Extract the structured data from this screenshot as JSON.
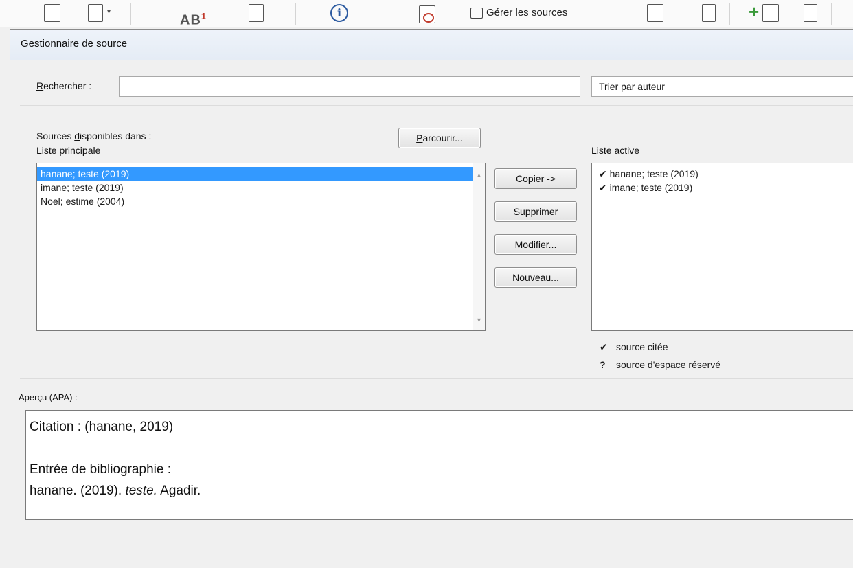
{
  "ribbon": {
    "manage_sources_label": "Gérer les sources",
    "ab_label": "AB",
    "ab_sup": "1",
    "info_glyph": "i"
  },
  "dialog": {
    "title": "Gestionnaire de source",
    "search": {
      "label_prefix": "R",
      "label_rest": "echercher :",
      "value": "",
      "placeholder": ""
    },
    "sort": {
      "selected": "Trier par auteur"
    },
    "available": {
      "label_line1_prefix": "Sources ",
      "label_line1_u": "d",
      "label_line1_rest": "isponibles dans :",
      "label_line2": "Liste principale",
      "browse_u": "P",
      "browse_rest": "arcourir...",
      "items": [
        {
          "text": "hanane; teste (2019)",
          "selected": true
        },
        {
          "text": "imane; teste (2019)",
          "selected": false
        },
        {
          "text": "Noel; estime (2004)",
          "selected": false
        }
      ]
    },
    "actions": {
      "copy_u": "C",
      "copy_rest": "opier ->",
      "delete_u": "S",
      "delete_rest": "upprimer",
      "edit_pre": "Modifi",
      "edit_u": "e",
      "edit_rest": "r...",
      "new_u": "N",
      "new_rest": "ouveau..."
    },
    "active": {
      "label_u": "L",
      "label_rest": "iste active",
      "items": [
        {
          "mark": "✔",
          "text": "hanane; teste (2019)"
        },
        {
          "mark": "✔",
          "text": "imane; teste (2019)"
        }
      ]
    },
    "legend": {
      "cited_symbol": "✔",
      "cited_label": "source citée",
      "placeholder_symbol": "?",
      "placeholder_label": "source d'espace réservé"
    },
    "preview": {
      "label": "Aperçu (APA) :",
      "citation": "Citation :  (hanane, 2019)",
      "bib_heading": "Entrée de bibliographie :",
      "bib_author": "hanane. (2019). ",
      "bib_title": "teste.",
      "bib_rest": " Agadir."
    }
  }
}
